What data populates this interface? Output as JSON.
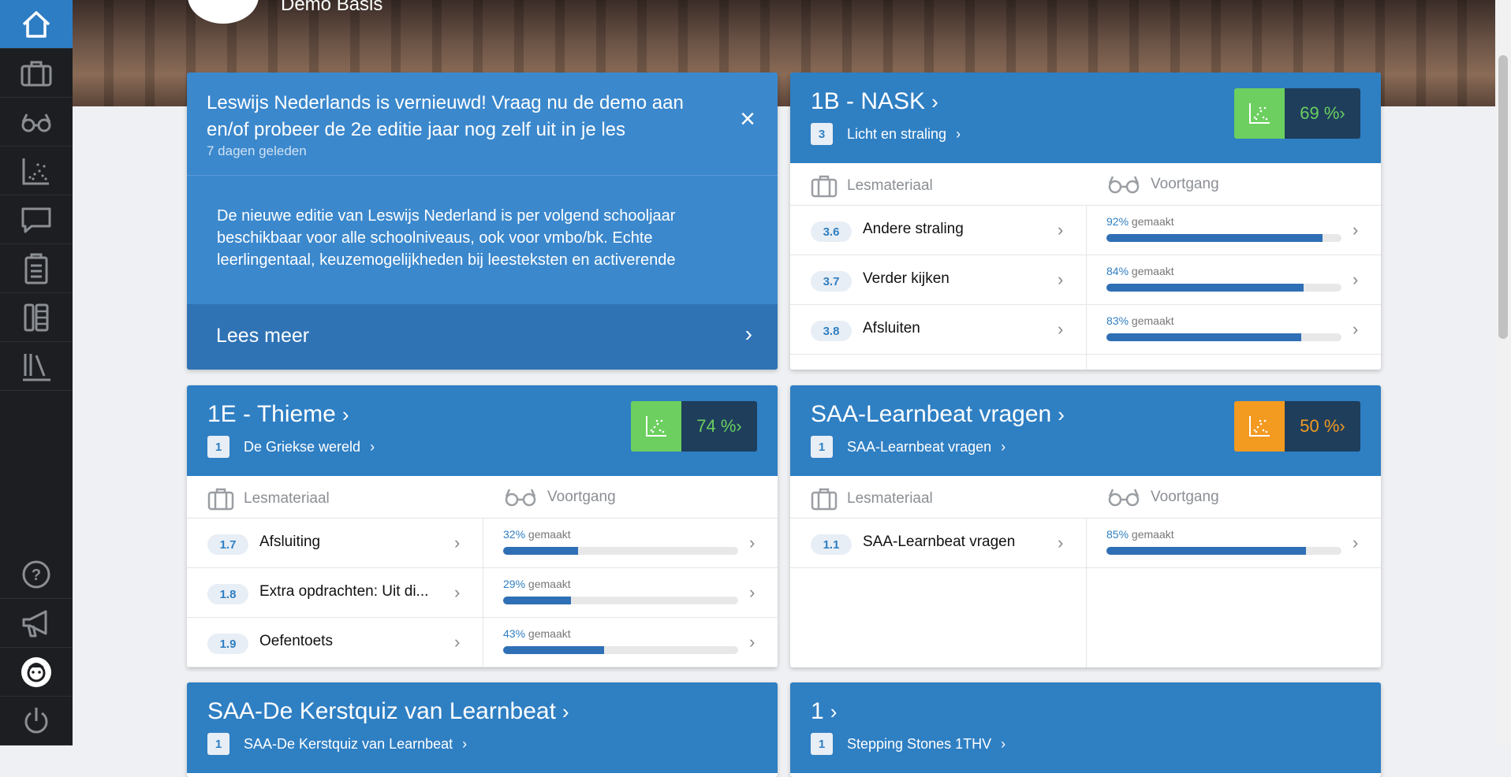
{
  "hero": {
    "school": "Demo Basis"
  },
  "sidebar": {
    "items": [
      "home-icon",
      "briefcase-icon",
      "glasses-icon",
      "chart-icon",
      "chat-icon",
      "clipboard-icon",
      "book-pen-icon",
      "library-icon"
    ],
    "bottom": [
      "help-icon",
      "megaphone-icon",
      "avatar",
      "power-icon"
    ]
  },
  "news": {
    "title": "Leswijs Nederlands is vernieuwd! Vraag nu de demo aan en/of probeer de 2e editie jaar nog zelf uit in je les",
    "date": "7 dagen geleden",
    "body": "De nieuwe editie van Leswijs Nederland is per volgend schooljaar beschikbaar voor alle schoolniveaus, ook voor vmbo/bk.  Echte leerlingentaal, keuzemogelijkheden bij leesteksten en activerende",
    "more": "Lees meer",
    "close": "×"
  },
  "labels": {
    "material": "Lesmateriaal",
    "progress": "Voortgang",
    "made": "gemaakt"
  },
  "cards": [
    {
      "title": "1B - NASK",
      "badge": "3",
      "subtitle": "Licht en straling",
      "score": "69 %",
      "score_color": "green",
      "rows": [
        {
          "num": "3.6",
          "name": "Andere straling",
          "pct": "92%",
          "fraction": 0.92
        },
        {
          "num": "3.7",
          "name": "Verder kijken",
          "pct": "84%",
          "fraction": 0.84
        },
        {
          "num": "3.8",
          "name": "Afsluiten",
          "pct": "83%",
          "fraction": 0.83
        }
      ]
    },
    {
      "title": "1E - Thieme",
      "badge": "1",
      "subtitle": "De Griekse wereld",
      "score": "74 %",
      "score_color": "green",
      "rows": [
        {
          "num": "1.7",
          "name": "Afsluiting",
          "pct": "32%",
          "fraction": 0.32
        },
        {
          "num": "1.8",
          "name": "Extra opdrachten: Uit di...",
          "pct": "29%",
          "fraction": 0.29
        },
        {
          "num": "1.9",
          "name": "Oefentoets",
          "pct": "43%",
          "fraction": 0.43
        }
      ]
    },
    {
      "title": "SAA-Learnbeat vragen",
      "badge": "1",
      "subtitle": "SAA-Learnbeat vragen",
      "score": "50 %",
      "score_color": "orange",
      "rows": [
        {
          "num": "1.1",
          "name": "SAA-Learnbeat vragen",
          "pct": "85%",
          "fraction": 0.85
        }
      ]
    },
    {
      "title": "SAA-De Kerstquiz van Learnbeat",
      "badge": "1",
      "subtitle": "SAA-De Kerstquiz van Learnbeat"
    },
    {
      "title": "1",
      "badge": "1",
      "subtitle": "Stepping Stones 1THV"
    }
  ]
}
